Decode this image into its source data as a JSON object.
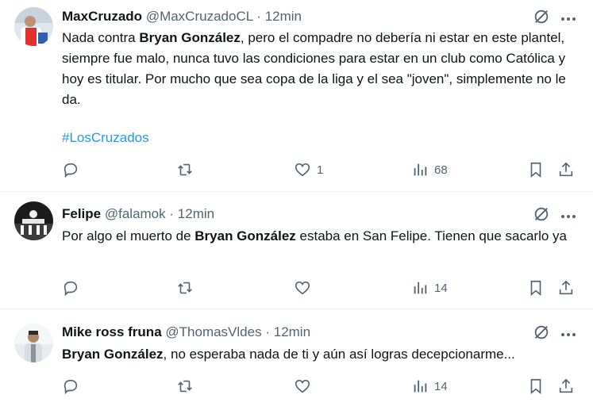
{
  "tweets": [
    {
      "name": "MaxCruzado",
      "handle": "@MaxCruzadoCL",
      "sep": "·",
      "time": "12min",
      "text_parts": [
        "Nada contra ",
        "Bryan González",
        ", pero el compadre no debería ni estar en este plantel, siempre fue malo, nunca tuvo las condiciones para estar en un club como Católica y hoy es titular. Por mucho que sea copa de la liga y el sea \"joven\", simplemente no le da."
      ],
      "hashtag": "#LosCruzados",
      "likes": "1",
      "views": "68"
    },
    {
      "name": "Felipe",
      "handle": "@falamok",
      "sep": "·",
      "time": "12min",
      "text_parts": [
        "Por algo el muerto de ",
        "Bryan González",
        " estaba en San Felipe. Tienen que sacarlo ya"
      ],
      "likes": "",
      "views": "14"
    },
    {
      "name": "Mike ross fruna",
      "handle": "@ThomasVldes",
      "sep": "·",
      "time": "12min",
      "text_parts": [
        "Bryan González",
        ", no esperaba nada de ti y aún así logras decepcionarme..."
      ],
      "likes": "",
      "views": "14"
    }
  ],
  "icons": {
    "grok": "grok-icon",
    "more": "more-icon",
    "reply": "reply-icon",
    "retweet": "retweet-icon",
    "like": "like-icon",
    "views": "views-icon",
    "bookmark": "bookmark-icon",
    "share": "share-icon"
  },
  "colors": {
    "link": "#1d9bf0",
    "secondary": "#536471",
    "text": "#0f1419",
    "divider": "#eff3f4"
  }
}
